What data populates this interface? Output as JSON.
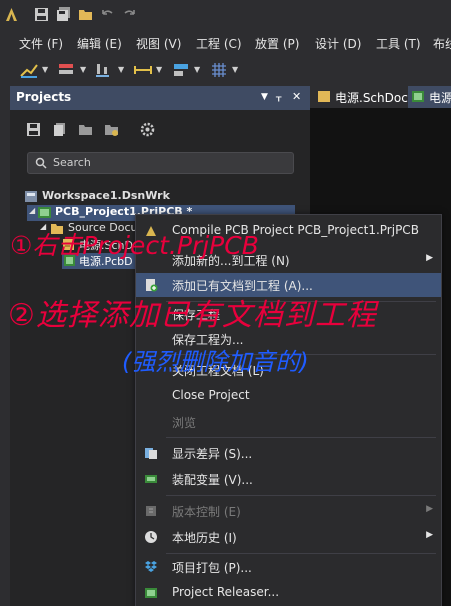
{
  "menubar": {
    "items": [
      "文件 (F)",
      "编辑 (E)",
      "视图 (V)",
      "工程 (C)",
      "放置 (P)",
      "设计 (D)",
      "工具 (T)",
      "布线"
    ]
  },
  "panel": {
    "title": "Projects",
    "search_placeholder": "Search",
    "tree": {
      "workspace": "Workspace1.DsnWrk",
      "project": "PCB_Project1.PrjPCB *",
      "folder": "Source Docu",
      "doc1": "电源.SchD",
      "doc2": "电源.PcbD"
    }
  },
  "tabs": [
    "电源.SchDoc",
    "电源"
  ],
  "context_menu": {
    "compile": "Compile PCB Project PCB_Project1.PrjPCB",
    "add_new": "添加新的...到工程 (N)",
    "add_existing": "添加已有文档到工程 (A)...",
    "save_project": "保存工程",
    "save_project_as": "保存工程为...",
    "close_docs": "关闭工程文档 (L)",
    "close_project": "Close Project",
    "browse": "浏览",
    "show_diff": "显示差异 (S)...",
    "variants": "装配变量 (V)...",
    "version_control": "版本控制 (E)",
    "local_history": "本地历史 (I)",
    "packager": "项目打包 (P)...",
    "releaser": "Project Releaser..."
  },
  "annotations": {
    "step1": "①右击Project.PrjPCB",
    "step2": "②选择添加已有文档到工程",
    "note": "(强烈删除加音的)"
  }
}
